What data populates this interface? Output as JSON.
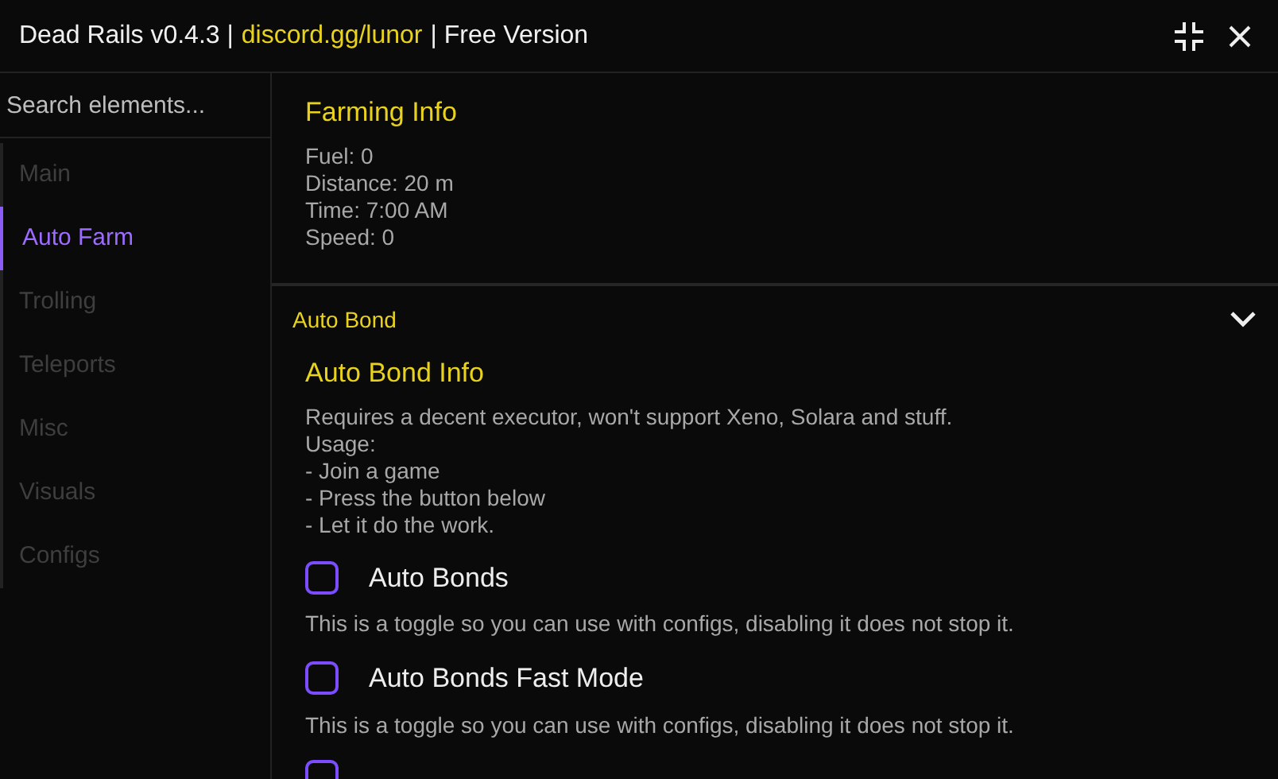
{
  "window": {
    "title_parts": [
      {
        "text": "Dead Rails v0.4.3 |",
        "kind": "plain"
      },
      {
        "text": "discord.gg/lunor",
        "kind": "link"
      },
      {
        "text": "| Free Version",
        "kind": "plain"
      }
    ]
  },
  "sidebar": {
    "search": {
      "placeholder": "Search elements..."
    },
    "items": [
      {
        "label": "Main",
        "selected": false
      },
      {
        "label": "Auto Farm",
        "selected": true
      },
      {
        "label": "Trolling",
        "selected": false
      },
      {
        "label": "Teleports",
        "selected": false
      },
      {
        "label": "Misc",
        "selected": false
      },
      {
        "label": "Visuals",
        "selected": false
      },
      {
        "label": "Configs",
        "selected": false
      }
    ]
  },
  "farming_info": {
    "title": "Farming Info",
    "lines": [
      "Fuel: 0",
      "Distance: 20 m",
      "Time: 7:00 AM",
      "Speed: 0"
    ]
  },
  "auto_bond": {
    "header": "Auto Bond",
    "expanded": true,
    "info": {
      "title": "Auto Bond Info",
      "lines": [
        "Requires a decent executor, won't support Xeno, Solara and stuff.",
        "Usage:",
        "- Join a game",
        "- Press the button below",
        "- Let it do the work."
      ]
    },
    "toggles": [
      {
        "label": "Auto Bonds",
        "checked": false,
        "description": "This is a toggle so you can use with configs, disabling it does not stop it."
      },
      {
        "label": "Auto Bonds Fast Mode",
        "checked": false,
        "description": "This is a toggle so you can use with configs, disabling it does not stop it."
      },
      {
        "checked": false
      }
    ]
  }
}
